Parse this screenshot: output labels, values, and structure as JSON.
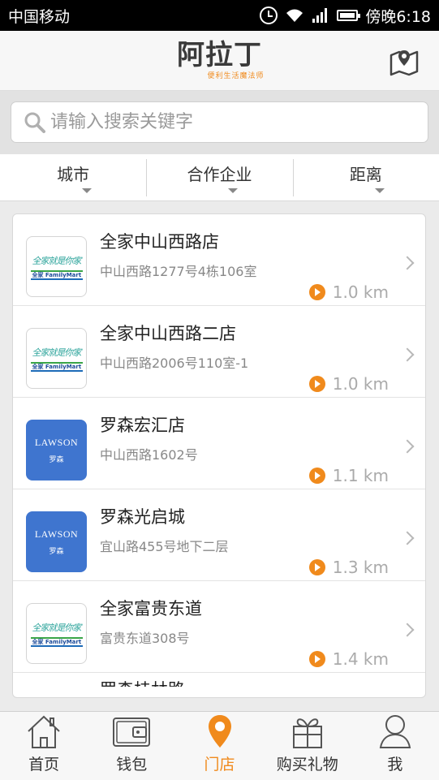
{
  "status_bar": {
    "carrier": "中国移动",
    "time": "傍晚6:18"
  },
  "header": {
    "logo_main": "阿拉丁",
    "logo_sub": "便利生活魔法师",
    "map_icon": "map-pin-icon"
  },
  "search": {
    "placeholder": "请输入搜索关键字"
  },
  "filters": [
    "城市",
    "合作企业",
    "距离"
  ],
  "stores": [
    {
      "name": "全家中山西路店",
      "address": "中山西路1277号4栋106室",
      "distance": "1.0 km",
      "brand": "familymart"
    },
    {
      "name": "全家中山西路二店",
      "address": "中山西路2006号110室-1",
      "distance": "1.0 km",
      "brand": "familymart"
    },
    {
      "name": "罗森宏汇店",
      "address": "中山西路1602号",
      "distance": "1.1 km",
      "brand": "lawson"
    },
    {
      "name": "罗森光启城",
      "address": "宜山路455号地下二层",
      "distance": "1.3 km",
      "brand": "lawson"
    },
    {
      "name": "全家富贵东道",
      "address": "富贵东道308号",
      "distance": "1.4 km",
      "brand": "familymart"
    }
  ],
  "partial_store": {
    "name": "罗森桂林路"
  },
  "brands": {
    "familymart": {
      "tagline": "全家就是你家",
      "logo": "全家 FamilyMart",
      "color": "#2aa39a"
    },
    "lawson": {
      "logo": "LAWSON",
      "sub": "罗森",
      "color": "#3f75cf"
    }
  },
  "tabs": [
    {
      "label": "首页",
      "icon": "home-icon"
    },
    {
      "label": "钱包",
      "icon": "wallet-icon"
    },
    {
      "label": "门店",
      "icon": "location-pin-icon",
      "active": true
    },
    {
      "label": "购买礼物",
      "icon": "gift-icon"
    },
    {
      "label": "我",
      "icon": "user-icon"
    }
  ],
  "colors": {
    "accent": "#f08a1c",
    "lawson_blue": "#3f75cf"
  }
}
